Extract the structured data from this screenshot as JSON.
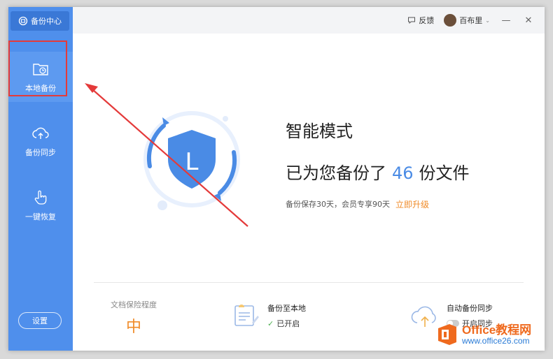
{
  "sidebar": {
    "brand": "备份中心",
    "items": [
      {
        "label": "本地备份"
      },
      {
        "label": "备份同步"
      },
      {
        "label": "一键恢复"
      }
    ],
    "settings": "设置"
  },
  "titlebar": {
    "feedback": "反馈",
    "username": "百布里",
    "minimize": "—",
    "close": "✕"
  },
  "main": {
    "mode_title": "智能模式",
    "count_prefix": "已为您备份了",
    "count_value": "46",
    "count_suffix": "份文件",
    "retention_text": "备份保存30天，会员专享90天",
    "upgrade_link": "立即升级",
    "shield_letter": "L"
  },
  "stats": {
    "protection_label": "文档保险程度",
    "protection_value": "中",
    "local_title": "备份至本地",
    "local_status": "已开启",
    "cloud_title": "自动备份同步",
    "cloud_status": "开启同步"
  },
  "watermark": {
    "line1": "Office教程网",
    "line2": "www.office26.com"
  },
  "colors": {
    "sidebar": "#4f8fec",
    "accent": "#4a8be5",
    "orange": "#f08c2a",
    "annotation_red": "#e43a3a"
  }
}
